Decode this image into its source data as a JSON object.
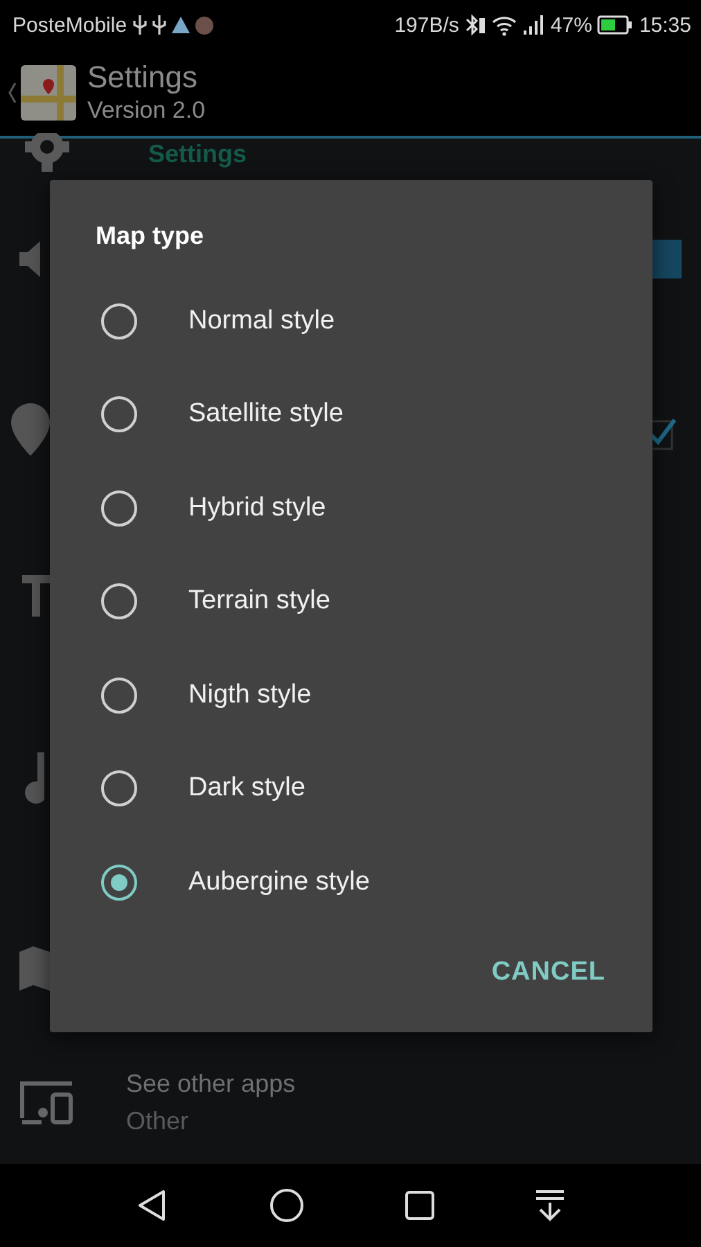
{
  "status_bar": {
    "carrier": "PosteMobile",
    "speed": "197B/s",
    "battery": "47%",
    "time": "15:35"
  },
  "app_bar": {
    "title": "Settings",
    "subtitle": "Version 2.0"
  },
  "category": {
    "label": "Settings"
  },
  "dialog": {
    "title": "Map type",
    "options": [
      {
        "label": "Normal style",
        "selected": false
      },
      {
        "label": "Satellite style",
        "selected": false
      },
      {
        "label": "Hybrid style",
        "selected": false
      },
      {
        "label": "Terrain style",
        "selected": false
      },
      {
        "label": "Nigth style",
        "selected": false
      },
      {
        "label": "Dark style",
        "selected": false
      },
      {
        "label": "Aubergine style",
        "selected": true
      }
    ],
    "cancel": "CANCEL"
  },
  "other_row": {
    "title": "See other apps",
    "subtitle": "Other"
  }
}
